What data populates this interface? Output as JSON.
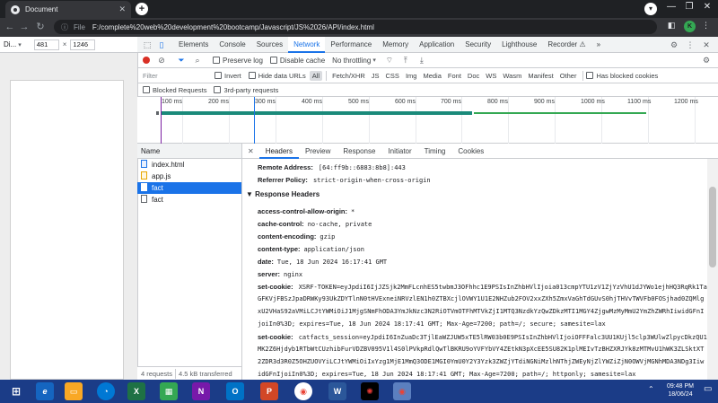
{
  "browser": {
    "tab_title": "Document",
    "tab_close": "✕",
    "new_tab": "+",
    "address_label": "File",
    "url": "F:/complete%20web%20development%20bootcamp/Javascript/JS%2026/API/index.html",
    "profile_initial": "K",
    "window_controls": [
      "—",
      "❐",
      "✕"
    ]
  },
  "device_toolbar": {
    "device": "Di...",
    "width": "481",
    "times": "×",
    "height": "1246"
  },
  "devtools": {
    "tabs": [
      "Elements",
      "Console",
      "Sources",
      "Network",
      "Performance",
      "Memory",
      "Application",
      "Security",
      "Lighthouse",
      "Recorder ⚠"
    ],
    "active_tab": "Network",
    "more": "»",
    "network_toolbar": {
      "preserve_log": "Preserve log",
      "disable_cache": "Disable cache",
      "throttling": "No throttling"
    },
    "filter": {
      "placeholder": "Filter",
      "invert": "Invert",
      "hide_data_urls": "Hide data URLs",
      "types": [
        "All",
        "Fetch/XHR",
        "JS",
        "CSS",
        "Img",
        "Media",
        "Font",
        "Doc",
        "WS",
        "Wasm",
        "Manifest",
        "Other"
      ],
      "has_blocked_cookies": "Has blocked cookies",
      "blocked_requests": "Blocked Requests",
      "third_party": "3rd-party requests"
    },
    "timeline_ticks": [
      "100 ms",
      "200 ms",
      "300 ms",
      "400 ms",
      "500 ms",
      "600 ms",
      "700 ms",
      "800 ms",
      "900 ms",
      "1000 ms",
      "1100 ms",
      "1200 ms"
    ],
    "request_list": {
      "header": "Name",
      "items": [
        {
          "name": "index.html",
          "kind": "doc"
        },
        {
          "name": "app.js",
          "kind": "js"
        },
        {
          "name": "fact",
          "kind": "fetch"
        },
        {
          "name": "fact",
          "kind": "fetch"
        }
      ],
      "selected_index": 2,
      "requests_count": "4 requests",
      "transferred": "4.5 kB transferred"
    },
    "detail_tabs": [
      "Headers",
      "Preview",
      "Response",
      "Initiator",
      "Timing",
      "Cookies"
    ],
    "active_detail_tab": "Headers",
    "general": [
      {
        "name": "Remote Address:",
        "value": "[64:ff9b::6883:8b8]:443"
      },
      {
        "name": "Referrer Policy:",
        "value": "strict-origin-when-cross-origin"
      }
    ],
    "response_headers_title": "Response Headers",
    "response_headers": [
      {
        "name": "access-control-allow-origin:",
        "value": "*"
      },
      {
        "name": "cache-control:",
        "value": "no-cache, private"
      },
      {
        "name": "content-encoding:",
        "value": "gzip"
      },
      {
        "name": "content-type:",
        "value": "application/json"
      },
      {
        "name": "date:",
        "value": "Tue, 18 Jun 2024 16:17:41 GMT"
      },
      {
        "name": "server:",
        "value": "nginx"
      }
    ],
    "set_cookie_1": {
      "name": "set-cookie:",
      "line1": "XSRF-TOKEN=eyJpdiI6IjJZSjk2MmFLcnhES5twbmJ3OFhhc1E9PSIsInZhbHVlIjoia013cmpYTU1zV1ZjYzVhU1dJYWo1ejhHQ3RqRk1Ta",
      "line2": "GFKVjFBSzJpaDRWKy93UkZDYTlnN0tHVExneiNRVzlEN1h0ZTBXcjlOVWY1U1E2NHZub2FOV2xxZXh5ZmxVaGhTdGUvS0hjTHVvTWVFb0FOSjhad0ZQMlg",
      "line3": "xU2VHaS92aVMiLCJtYWMiOiJ1MjgSNmFhODA3YmJkNzc3N2RiOTVmOTFhMTVkZjI1MTQ3NzdkYzQwZDkzMTI1MGY4ZjgwMzMyMmU2YmZhZWRhIiwidGFnI",
      "line4": "joiIn0%3D; expires=Tue, 18 Jun 2024 18:17:41 GMT; Max-Age=7200; path=/; secure; samesite=lax"
    },
    "set_cookie_2": {
      "name": "set-cookie:",
      "line1": "catfacts_session=eyJpdiI6InZuaDc3TjlEaWZJUW5xTE5lRW03b0E9PSIsInZhbHVlIjoiOFFFalc3UU1KUjl5clp3WUlwZlpycDkzQU1",
      "line2": "MK2Z6Hjdyb1RTbWtCUzhibFurVDZBV095V1l4S0lPVkpRdlQwTlBKRU9oYVFYbVY4ZEtkN3pXcEE5SU82K1plMEIvTzBHZXRJYk8zMTMvU1hWK3ZLSktXT",
      "line3": "2ZDR3d3R0Z5OHZUOVYiLCJtYWMiOiIxYzg1MjE1MmQ3ODE1MGI0YmU0Y2Y3Yzk3ZWZjYTdiNGNiMzlhNThjZWEyNjZlYWZiZjN0OWVjMGNhMDA3NDg3Iiw",
      "line4": "idGFnIjoiIn0%3D; expires=Tue, 18 Jun 2024 18:17:41 GMT; Max-Age=7200; path=/; httponly; samesite=lax"
    }
  },
  "taskbar": {
    "time": "09:48 PM",
    "date": "18/06/24"
  },
  "colors": {
    "accent": "#1a73e8",
    "taskbar": "#1b3c87",
    "bar_green": "#34a853",
    "bar_teal": "#1a8a7a"
  }
}
